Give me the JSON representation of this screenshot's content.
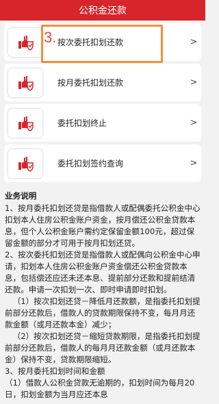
{
  "header": {
    "title": "公积金还款"
  },
  "menu": [
    {
      "label": "按次委托扣划还款"
    },
    {
      "label": "按月委托扣划还款"
    },
    {
      "label": "委托扣划终止"
    },
    {
      "label": "委托扣划签约查询"
    }
  ],
  "annotation": {
    "step": "3."
  },
  "content": {
    "title": "业务说明",
    "paragraphs": [
      "1、按月委托扣划还贷是指借款人或配偶委托公积金中心扣划本人住房公积金账户资金，按月偿还公积金贷款本息，但个人公积金账户需约定保留金额100元，超过保留金额的部分才可用于按月扣划还贷。",
      "2、按次委托扣划还贷是指借款人或配偶向公积金中心申请，扣划本人住房公积金账户资金偿还公积金贷款本息，包括偿还应还未还本息、提前部分还款和提前结清还款。申请一次扣划一次、即时申请即时扣划。",
      "（1）按次扣划还贷－降低月还款额，是指委托扣划提前部分还款后，借款人的贷款期限保持不变，每月月还款金额（或月还款本金）减少；",
      "（2）按次扣划还贷－缩短贷款期限，是指委托扣划提前部分还款后，借款人的每月月还款金额（或月还款本金）保持不变，贷款期限缩短。",
      "3、按月委托扣划时间和金额",
      "（1）借款人公积金贷款无逾期的，扣划时间为每月20日，扣划金额为当月应还本息"
    ]
  },
  "colors": {
    "brand": "#d6262b",
    "highlight": "#f0913a",
    "step": "#e24b4b"
  },
  "icons": [
    "hand-shield-icon",
    "chevron-right-icon"
  ]
}
